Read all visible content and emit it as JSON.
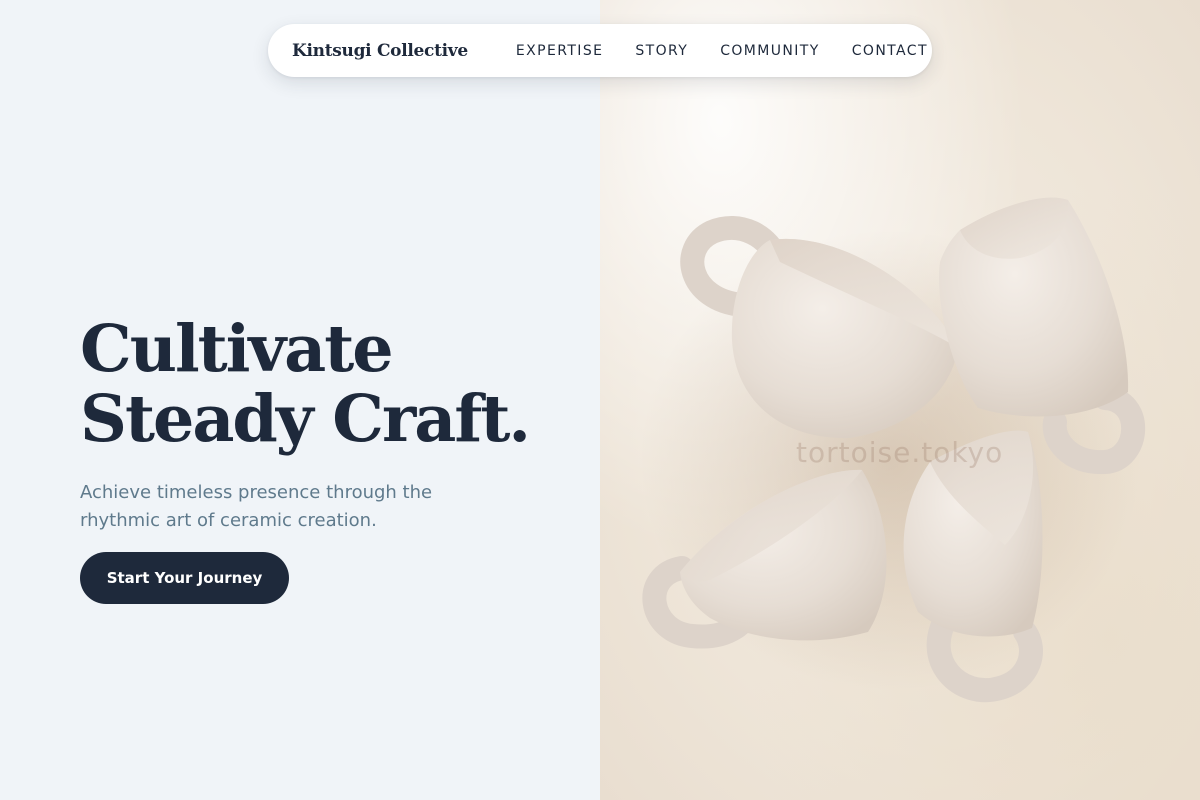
{
  "brand": {
    "name": "Kintsugi Collective"
  },
  "nav": {
    "links": [
      {
        "label": "EXPERTISE"
      },
      {
        "label": "STORY"
      },
      {
        "label": "COMMUNITY"
      },
      {
        "label": "CONTACT"
      }
    ]
  },
  "hero": {
    "title_line_1": "Cultivate",
    "title_line_2": "Steady Craft.",
    "subtitle": "Achieve timeless presence through the rhythmic art of ceramic creation.",
    "cta_label": "Start Your Journey"
  },
  "photo": {
    "watermark": "tortoise.tokyo",
    "subject": "four-stacked-handmade-ceramic-cups"
  },
  "colors": {
    "primary": "#1e293b",
    "muted_text": "#5f7a8c",
    "left_background": "#f0f4f8",
    "nav_background": "#ffffff",
    "photo_background": "#efe7dc",
    "clay": "#e8dfd6"
  }
}
